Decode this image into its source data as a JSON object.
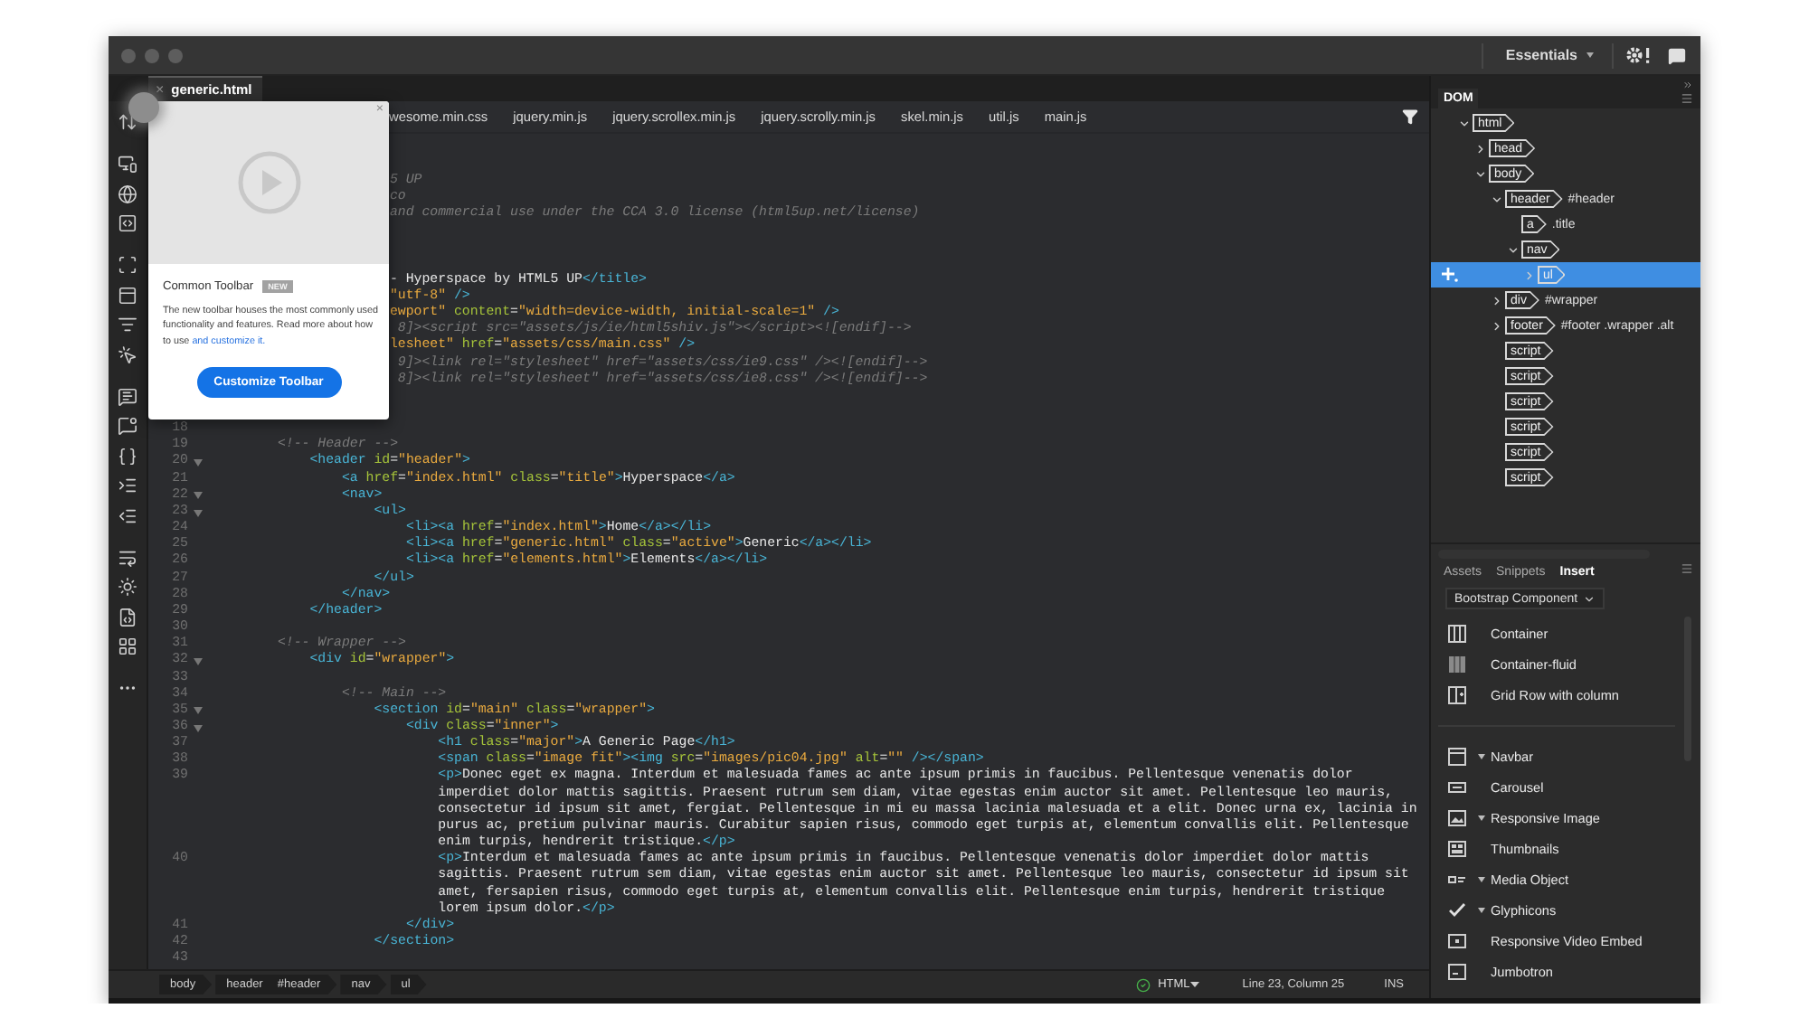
{
  "workspace": {
    "label": "Essentials"
  },
  "document_tab": {
    "close": "×",
    "title": "generic.html",
    "selected": true
  },
  "related_files": [
    "wesome.min.css",
    "jquery.min.js",
    "jquery.scrollex.min.js",
    "jquery.scrolly.min.js",
    "skel.min.js",
    "util.js",
    "main.js"
  ],
  "popup": {
    "close": "×",
    "title": "Common Toolbar",
    "badge": "NEW",
    "body": "The new toolbar houses the most commonly used functionality and features. Read more about how to use ",
    "link": "and customize it.",
    "button": "Customize Toolbar"
  },
  "code": {
    "lines": [
      {
        "kind": "covered"
      },
      {
        "kind": "covered"
      },
      {
        "kind": "fragment",
        "tokens": [
          {
            "kind": "com",
            "text": "5 UP"
          }
        ]
      },
      {
        "kind": "fragment",
        "tokens": [
          {
            "kind": "com",
            "text": "co"
          }
        ]
      },
      {
        "kind": "fragment",
        "tokens": [
          {
            "kind": "com",
            "text": "and commercial use under the CCA 3.0 license (html5up.net/license)"
          }
        ]
      },
      {
        "kind": "covered"
      },
      {
        "kind": "covered"
      },
      {
        "kind": "covered"
      },
      {
        "kind": "fragment",
        "tokens": [
          {
            "kind": "text",
            "text": "- Hyperspace by HTML5 UP"
          },
          {
            "kind": "tag",
            "text": "</title>"
          }
        ]
      },
      {
        "kind": "fragment",
        "tokens": [
          {
            "kind": "val",
            "text": "\"utf-8\""
          },
          {
            "kind": "tag",
            "text": " />"
          }
        ]
      },
      {
        "kind": "fragment",
        "tokens": [
          {
            "kind": "val",
            "text": "ewport\""
          },
          {
            "kind": "attr",
            "text": " content"
          },
          {
            "kind": "p",
            "text": "="
          },
          {
            "kind": "val",
            "text": "\"width=device-width, initial-scale=1\""
          },
          {
            "kind": "tag",
            "text": " />"
          }
        ]
      },
      {
        "kind": "fragment",
        "tokens": [
          {
            "kind": "com",
            "text": " 8]><script src=\"assets/js/ie/html5shiv.js\"></script><![endif]-->"
          }
        ]
      },
      {
        "kind": "fragment",
        "tokens": [
          {
            "kind": "val",
            "text": "lesheet\""
          },
          {
            "kind": "attr",
            "text": " href"
          },
          {
            "kind": "p",
            "text": "="
          },
          {
            "kind": "val",
            "text": "\"assets/css/main.css\""
          },
          {
            "kind": "tag",
            "text": " />"
          }
        ]
      },
      {
        "kind": "fragment",
        "tokens": [
          {
            "kind": "com",
            "text": " 9]><link rel=\"stylesheet\" href=\"assets/css/ie9.css\" /><![endif]-->"
          }
        ]
      },
      {
        "kind": "fragment",
        "tokens": [
          {
            "kind": "com",
            "text": " 8]><link rel=\"stylesheet\" href=\"assets/css/ie8.css\" /><![endif]-->"
          }
        ]
      },
      {
        "kind": "covered"
      },
      {
        "kind": "covered"
      },
      {
        "kind": "code",
        "number": "18",
        "fold": false
      },
      {
        "kind": "code",
        "number": "19",
        "fold": false,
        "tokens": [
          {
            "kind": "com",
            "text": "        <!-- Header -->"
          }
        ]
      },
      {
        "kind": "code",
        "number": "20",
        "fold": true,
        "tokens": [
          {
            "kind": "tag",
            "text": "            <header"
          },
          {
            "kind": "attr",
            "text": " id"
          },
          {
            "kind": "p",
            "text": "="
          },
          {
            "kind": "val",
            "text": "\"header\""
          },
          {
            "kind": "tag",
            "text": ">"
          }
        ]
      },
      {
        "kind": "code",
        "number": "21",
        "fold": false,
        "tokens": [
          {
            "kind": "tag",
            "text": "                <a"
          },
          {
            "kind": "attr",
            "text": " href"
          },
          {
            "kind": "p",
            "text": "="
          },
          {
            "kind": "val",
            "text": "\"index.html\""
          },
          {
            "kind": "attr",
            "text": " class"
          },
          {
            "kind": "p",
            "text": "="
          },
          {
            "kind": "val",
            "text": "\"title\""
          },
          {
            "kind": "tag",
            "text": ">"
          },
          {
            "kind": "text",
            "text": "Hyperspace"
          },
          {
            "kind": "tag",
            "text": "</a>"
          }
        ]
      },
      {
        "kind": "code",
        "number": "22",
        "fold": true,
        "tokens": [
          {
            "kind": "tag",
            "text": "                <nav>"
          }
        ]
      },
      {
        "kind": "code",
        "number": "23",
        "fold": true,
        "tokens": [
          {
            "kind": "tag",
            "text": "                    <ul>"
          }
        ]
      },
      {
        "kind": "code",
        "number": "24",
        "fold": false,
        "tokens": [
          {
            "kind": "tag",
            "text": "                        <li><a"
          },
          {
            "kind": "attr",
            "text": " href"
          },
          {
            "kind": "p",
            "text": "="
          },
          {
            "kind": "val",
            "text": "\"index.html\""
          },
          {
            "kind": "tag",
            "text": ">"
          },
          {
            "kind": "text",
            "text": "Home"
          },
          {
            "kind": "tag",
            "text": "</a></li>"
          }
        ]
      },
      {
        "kind": "code",
        "number": "25",
        "fold": false,
        "tokens": [
          {
            "kind": "tag",
            "text": "                        <li><a"
          },
          {
            "kind": "attr",
            "text": " href"
          },
          {
            "kind": "p",
            "text": "="
          },
          {
            "kind": "val",
            "text": "\"generic.html\""
          },
          {
            "kind": "attr",
            "text": " class"
          },
          {
            "kind": "p",
            "text": "="
          },
          {
            "kind": "val",
            "text": "\"active\""
          },
          {
            "kind": "tag",
            "text": ">"
          },
          {
            "kind": "text",
            "text": "Generic"
          },
          {
            "kind": "tag",
            "text": "</a></li>"
          }
        ]
      },
      {
        "kind": "code",
        "number": "26",
        "fold": false,
        "tokens": [
          {
            "kind": "tag",
            "text": "                        <li><a"
          },
          {
            "kind": "attr",
            "text": " href"
          },
          {
            "kind": "p",
            "text": "="
          },
          {
            "kind": "val",
            "text": "\"elements.html\""
          },
          {
            "kind": "tag",
            "text": ">"
          },
          {
            "kind": "text",
            "text": "Elements"
          },
          {
            "kind": "tag",
            "text": "</a></li>"
          }
        ]
      },
      {
        "kind": "code",
        "number": "27",
        "fold": false,
        "tokens": [
          {
            "kind": "tag",
            "text": "                    </ul>"
          }
        ]
      },
      {
        "kind": "code",
        "number": "28",
        "fold": false,
        "tokens": [
          {
            "kind": "tag",
            "text": "                </nav>"
          }
        ]
      },
      {
        "kind": "code",
        "number": "29",
        "fold": false,
        "tokens": [
          {
            "kind": "tag",
            "text": "            </header>"
          }
        ]
      },
      {
        "kind": "code",
        "number": "30",
        "fold": false
      },
      {
        "kind": "code",
        "number": "31",
        "fold": false,
        "tokens": [
          {
            "kind": "com",
            "text": "        <!-- Wrapper -->"
          }
        ]
      },
      {
        "kind": "code",
        "number": "32",
        "fold": true,
        "tokens": [
          {
            "kind": "tag",
            "text": "            <div"
          },
          {
            "kind": "attr",
            "text": " id"
          },
          {
            "kind": "p",
            "text": "="
          },
          {
            "kind": "val",
            "text": "\"wrapper\""
          },
          {
            "kind": "tag",
            "text": ">"
          }
        ]
      },
      {
        "kind": "code",
        "number": "33",
        "fold": false
      },
      {
        "kind": "code",
        "number": "34",
        "fold": false,
        "tokens": [
          {
            "kind": "com",
            "text": "                <!-- Main -->"
          }
        ]
      },
      {
        "kind": "code",
        "number": "35",
        "fold": true,
        "tokens": [
          {
            "kind": "tag",
            "text": "                    <section"
          },
          {
            "kind": "attr",
            "text": " id"
          },
          {
            "kind": "p",
            "text": "="
          },
          {
            "kind": "val",
            "text": "\"main\""
          },
          {
            "kind": "attr",
            "text": " class"
          },
          {
            "kind": "p",
            "text": "="
          },
          {
            "kind": "val",
            "text": "\"wrapper\""
          },
          {
            "kind": "tag",
            "text": ">"
          }
        ]
      },
      {
        "kind": "code",
        "number": "36",
        "fold": true,
        "tokens": [
          {
            "kind": "tag",
            "text": "                        <div"
          },
          {
            "kind": "attr",
            "text": " class"
          },
          {
            "kind": "p",
            "text": "="
          },
          {
            "kind": "val",
            "text": "\"inner\""
          },
          {
            "kind": "tag",
            "text": ">"
          }
        ]
      },
      {
        "kind": "code",
        "number": "37",
        "fold": false,
        "tokens": [
          {
            "kind": "tag",
            "text": "                            <h1"
          },
          {
            "kind": "attr",
            "text": " class"
          },
          {
            "kind": "p",
            "text": "="
          },
          {
            "kind": "val",
            "text": "\"major\""
          },
          {
            "kind": "tag",
            "text": ">"
          },
          {
            "kind": "text",
            "text": "A Generic Page"
          },
          {
            "kind": "tag",
            "text": "</h1>"
          }
        ]
      },
      {
        "kind": "code",
        "number": "38",
        "fold": false,
        "tokens": [
          {
            "kind": "tag",
            "text": "                            <span"
          },
          {
            "kind": "attr",
            "text": " class"
          },
          {
            "kind": "p",
            "text": "="
          },
          {
            "kind": "val",
            "text": "\"image fit\""
          },
          {
            "kind": "tag",
            "text": "><img"
          },
          {
            "kind": "attr",
            "text": " src"
          },
          {
            "kind": "p",
            "text": "="
          },
          {
            "kind": "val",
            "text": "\"images/pic04.jpg\""
          },
          {
            "kind": "attr",
            "text": " alt"
          },
          {
            "kind": "p",
            "text": "="
          },
          {
            "kind": "val",
            "text": "\"\""
          },
          {
            "kind": "tag",
            "text": " /></span>"
          }
        ]
      },
      {
        "kind": "code",
        "number": "39",
        "fold": false,
        "tokens": [
          {
            "kind": "tag",
            "text": "                            <p>"
          },
          {
            "kind": "text",
            "text": "Donec eget ex magna. Interdum et malesuada fames ac ante ipsum primis in faucibus. Pellentesque venenatis dolor"
          }
        ]
      },
      {
        "kind": "code",
        "tokens": [
          {
            "kind": "text",
            "text": "                            imperdiet dolor mattis sagittis. Praesent rutrum sem diam, vitae egestas enim auctor sit amet. Pellentesque leo mauris,"
          }
        ]
      },
      {
        "kind": "code",
        "tokens": [
          {
            "kind": "text",
            "text": "                            consectetur id ipsum sit amet, fergiat. Pellentesque in mi eu massa lacinia malesuada et a elit. Donec urna ex, lacinia in"
          }
        ]
      },
      {
        "kind": "code",
        "tokens": [
          {
            "kind": "text",
            "text": "                            purus ac, pretium pulvinar mauris. Curabitur sapien risus, commodo eget turpis at, elementum convallis elit. Pellentesque"
          }
        ]
      },
      {
        "kind": "code",
        "tokens": [
          {
            "kind": "text",
            "text": "                            enim turpis, hendrerit tristique."
          },
          {
            "kind": "tag",
            "text": "</p>"
          }
        ]
      },
      {
        "kind": "code",
        "number": "40",
        "fold": false,
        "tokens": [
          {
            "kind": "tag",
            "text": "                            <p>"
          },
          {
            "kind": "text",
            "text": "Interdum et malesuada fames ac ante ipsum primis in faucibus. Pellentesque venenatis dolor imperdiet dolor mattis"
          }
        ]
      },
      {
        "kind": "code",
        "tokens": [
          {
            "kind": "text",
            "text": "                            sagittis. Praesent rutrum sem diam, vitae egestas enim auctor sit amet. Pellentesque leo mauris, consectetur id ipsum sit"
          }
        ]
      },
      {
        "kind": "code",
        "tokens": [
          {
            "kind": "text",
            "text": "                            amet, fersapien risus, commodo eget turpis at, elementum convallis elit. Pellentesque enim turpis, hendrerit tristique"
          }
        ]
      },
      {
        "kind": "code",
        "tokens": [
          {
            "kind": "text",
            "text": "                            lorem ipsum dolor."
          },
          {
            "kind": "tag",
            "text": "</p>"
          }
        ]
      },
      {
        "kind": "code",
        "number": "41",
        "fold": false,
        "tokens": [
          {
            "kind": "tag",
            "text": "                        </div>"
          }
        ]
      },
      {
        "kind": "code",
        "number": "42",
        "fold": false,
        "tokens": [
          {
            "kind": "tag",
            "text": "                    </section>"
          }
        ]
      },
      {
        "kind": "code",
        "number": "43",
        "fold": false
      }
    ]
  },
  "status_bar": {
    "breadcrumbs": [
      {
        "tag": "body"
      },
      {
        "tag": "header",
        "detail": "#header"
      },
      {
        "tag": "nav"
      },
      {
        "tag": "ul"
      }
    ],
    "language": "HTML",
    "position": "Line 23, Column 25",
    "mode": "INS"
  },
  "dom_panel": {
    "tab": "DOM",
    "nodes": [
      {
        "tag": "html",
        "expanded": true,
        "selected": false,
        "children": [
          {
            "tag": "head",
            "expanded": false,
            "selected": false
          },
          {
            "tag": "body",
            "expanded": true,
            "selected": false,
            "children": [
              {
                "tag": "header",
                "detail": "#header",
                "expanded": true,
                "selected": false,
                "children": [
                  {
                    "tag": "a",
                    "detail": ".title",
                    "selected": false
                  },
                  {
                    "tag": "nav",
                    "expanded": true,
                    "selected": false,
                    "children": [
                      {
                        "tag": "ul",
                        "expanded": false,
                        "selected": true
                      }
                    ]
                  }
                ]
              },
              {
                "tag": "div",
                "detail": "#wrapper",
                "expanded": false,
                "selected": false
              },
              {
                "tag": "footer",
                "detail": "#footer .wrapper .alt",
                "expanded": false,
                "selected": false
              },
              {
                "tag": "script",
                "selected": false
              },
              {
                "tag": "script",
                "selected": false
              },
              {
                "tag": "script",
                "selected": false
              },
              {
                "tag": "script",
                "selected": false
              },
              {
                "tag": "script",
                "selected": false
              },
              {
                "tag": "script",
                "selected": false
              }
            ]
          }
        ]
      }
    ]
  },
  "insert_panel": {
    "tabs": [
      {
        "label": "Assets",
        "selected": false
      },
      {
        "label": "Snippets",
        "selected": false
      },
      {
        "label": "Insert",
        "selected": true
      }
    ],
    "category": "Bootstrap Component",
    "groups": [
      [
        {
          "label": "Container",
          "expandable": false
        },
        {
          "label": "Container-fluid",
          "expandable": false
        },
        {
          "label": "Grid Row with column",
          "expandable": false
        }
      ],
      [
        {
          "label": "Navbar",
          "expandable": true
        },
        {
          "label": "Carousel",
          "expandable": false
        },
        {
          "label": "Responsive Image",
          "expandable": true
        },
        {
          "label": "Thumbnails",
          "expandable": false
        },
        {
          "label": "Media Object",
          "expandable": true
        },
        {
          "label": "Glyphicons",
          "expandable": true
        },
        {
          "label": "Responsive Video Embed",
          "expandable": false
        },
        {
          "label": "Jumbotron",
          "expandable": false
        }
      ]
    ]
  }
}
